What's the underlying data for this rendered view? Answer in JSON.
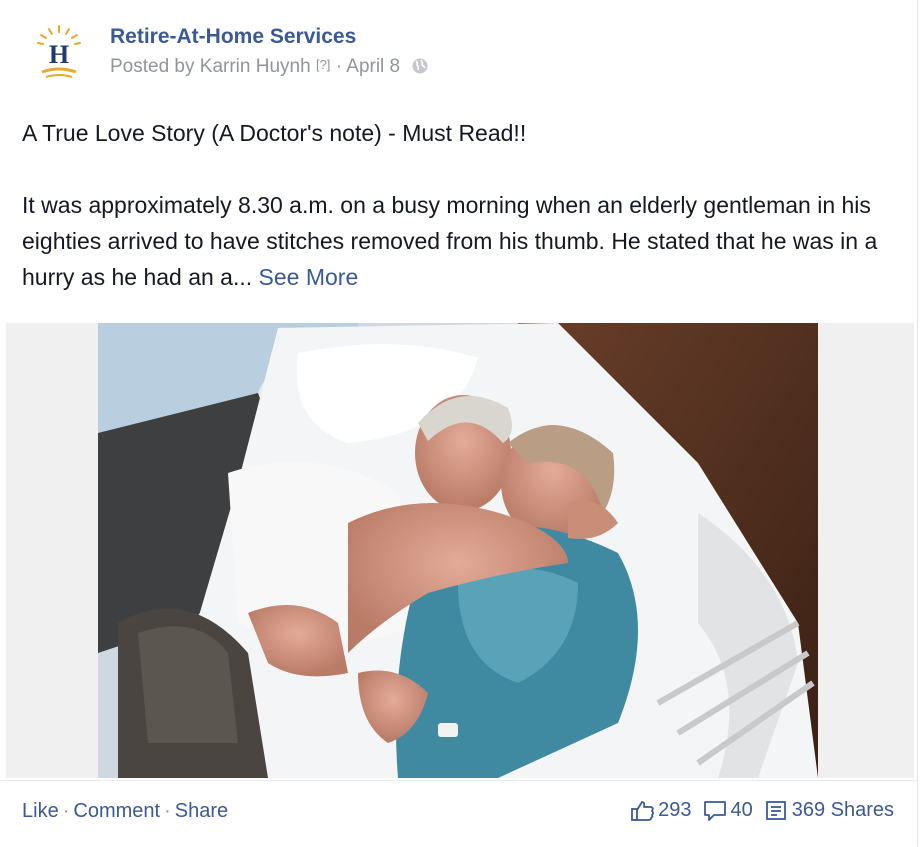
{
  "post": {
    "page_name": "Retire-At-Home Services",
    "posted_by_prefix": "Posted by",
    "author": "Karrin Huynh",
    "help_mark": "[?]",
    "separator": "·",
    "date": "April 8",
    "title": "A True Love Story (A Doctor's note) - Must Read!!",
    "body": "It was approximately 8.30 a.m. on a busy morning when an elderly gentleman in his eighties arrived to have stitches removed from his thumb. He stated that he was in a hurry as he had an a...",
    "see_more": "See More",
    "logo_letter": "H",
    "privacy_icon": "globe-icon"
  },
  "actions": {
    "like": "Like",
    "comment": "Comment",
    "share": "Share",
    "separator": "·"
  },
  "stats": {
    "likes": "293",
    "comments": "40",
    "shares": "369 Shares",
    "like_icon": "thumbs-up-icon",
    "comment_icon": "comment-bubble-icon",
    "share_icon": "share-icon"
  },
  "colors": {
    "link": "#3b5998",
    "meta": "#90949c",
    "text": "#141823",
    "logo_gold": "#e8a92b",
    "logo_navy": "#1f3a6e"
  }
}
